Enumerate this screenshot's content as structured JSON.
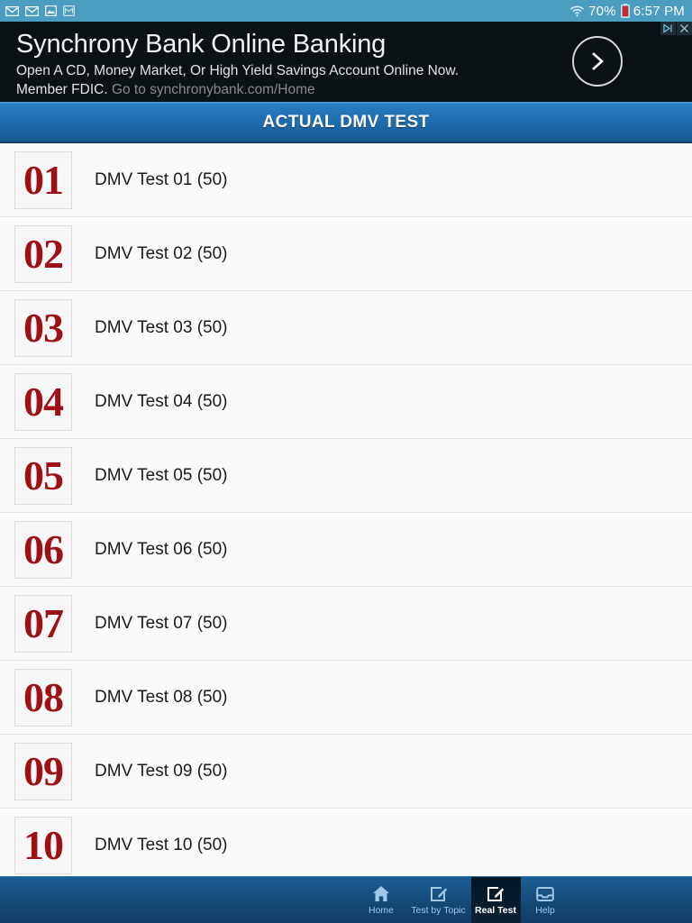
{
  "status_bar": {
    "icons": [
      "envelope-icon",
      "envelope-icon",
      "image-icon",
      "gmail-icon"
    ],
    "wifi_icon": "wifi-icon",
    "battery_percent": "70%",
    "battery_icon": "battery-low-icon",
    "time": "6:57 PM",
    "background_color": "#4a9cc0"
  },
  "ad": {
    "title": "Synchrony Bank Online Banking",
    "line2": "Open A CD, Money Market, Or High Yield Savings Account Online Now.",
    "line3_bold": "Member FDIC.",
    "line3_url": "Go to synchronybank.com/Home",
    "cta_icon": "chevron-right-icon",
    "adchoices_icon": "adchoices-icon",
    "close_icon": "close-icon",
    "background_color": "#0b1216"
  },
  "header": {
    "title": "ACTUAL DMV TEST",
    "accent_color": "#1f6cb0"
  },
  "list": {
    "items": [
      {
        "number": "01",
        "label": "DMV Test 01 (50)"
      },
      {
        "number": "02",
        "label": "DMV Test 02 (50)"
      },
      {
        "number": "03",
        "label": "DMV Test 03 (50)"
      },
      {
        "number": "04",
        "label": "DMV Test 04 (50)"
      },
      {
        "number": "05",
        "label": "DMV Test 05 (50)"
      },
      {
        "number": "06",
        "label": "DMV Test 06 (50)"
      },
      {
        "number": "07",
        "label": "DMV Test 07 (50)"
      },
      {
        "number": "08",
        "label": "DMV Test 08 (50)"
      },
      {
        "number": "09",
        "label": "DMV Test 09 (50)"
      },
      {
        "number": "10",
        "label": "DMV Test 10 (50)"
      }
    ],
    "number_color": "#9e1014",
    "background_color": "#fafafa"
  },
  "bottom_nav": {
    "items": [
      {
        "label": "Home",
        "icon": "home-icon",
        "active": false
      },
      {
        "label": "Test by Topic",
        "icon": "edit-note-icon",
        "active": false
      },
      {
        "label": "Real Test",
        "icon": "edit-note-icon",
        "active": true
      },
      {
        "label": "Help",
        "icon": "inbox-icon",
        "active": false
      }
    ],
    "active_color": "#ffffff",
    "inactive_color": "#9ec8e6"
  }
}
